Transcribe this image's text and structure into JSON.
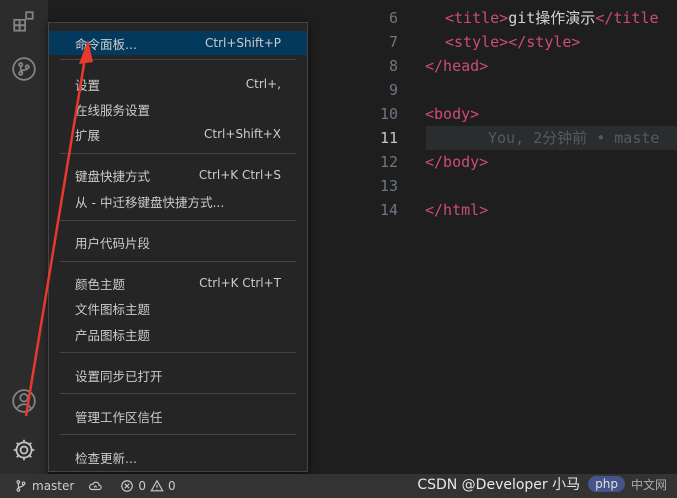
{
  "menu": {
    "items": [
      {
        "label": "命令面板...",
        "kb": "Ctrl+Shift+P"
      },
      {
        "label": "设置",
        "kb": "Ctrl+,"
      },
      {
        "label": "在线服务设置",
        "kb": ""
      },
      {
        "label": "扩展",
        "kb": "Ctrl+Shift+X"
      },
      {
        "label": "键盘快捷方式",
        "kb": "Ctrl+K Ctrl+S"
      },
      {
        "label": "从 - 中迁移键盘快捷方式...",
        "kb": ""
      },
      {
        "label": "用户代码片段",
        "kb": ""
      },
      {
        "label": "颜色主题",
        "kb": "Ctrl+K Ctrl+T"
      },
      {
        "label": "文件图标主题",
        "kb": ""
      },
      {
        "label": "产品图标主题",
        "kb": ""
      },
      {
        "label": "设置同步已打开",
        "kb": ""
      },
      {
        "label": "管理工作区信任",
        "kb": ""
      },
      {
        "label": "检查更新...",
        "kb": ""
      }
    ]
  },
  "editor": {
    "lines": [
      {
        "num": "6",
        "tag_open": "<title>",
        "text": "git操作演示",
        "tag_close": "</title"
      },
      {
        "num": "7",
        "tag_open": "<style>",
        "text": "",
        "tag_close": "</style>"
      },
      {
        "num": "8",
        "tag_open": "</head>",
        "text": "",
        "tag_close": ""
      },
      {
        "num": "9",
        "tag_open": "",
        "text": "",
        "tag_close": ""
      },
      {
        "num": "10",
        "tag_open": "<body>",
        "text": "",
        "tag_close": ""
      },
      {
        "num": "11",
        "tag_open": "",
        "text": "",
        "tag_close": ""
      },
      {
        "num": "12",
        "tag_open": "</body>",
        "text": "",
        "tag_close": ""
      },
      {
        "num": "13",
        "tag_open": "",
        "text": "",
        "tag_close": ""
      },
      {
        "num": "14",
        "tag_open": "</html>",
        "text": "",
        "tag_close": ""
      }
    ],
    "blame": "You, 2分钟前 • maste"
  },
  "status": {
    "branch": "master",
    "errors": "0",
    "warnings": "0"
  },
  "watermark": {
    "text": "CSDN @Developer 小马",
    "badge": "php",
    "badge_cn": "中文网"
  },
  "colors": {
    "tag": "#ce4a79",
    "arrow": "#e8392e",
    "selection": "#04395e"
  }
}
